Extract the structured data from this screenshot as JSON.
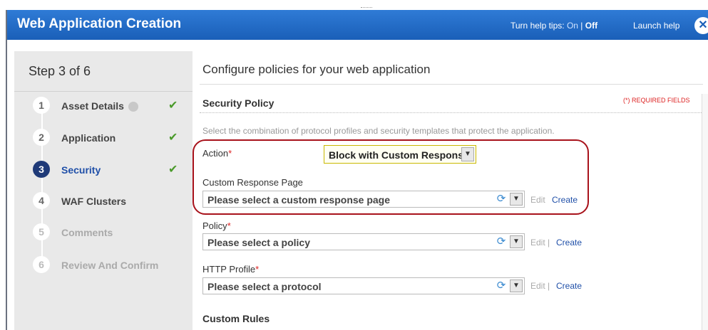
{
  "window": {
    "title": "Web Application Creation",
    "help_tips_label": "Turn help tips:",
    "help_on": "On",
    "help_sep": "|",
    "help_off": "Off",
    "launch_help": "Launch help",
    "close_icon": "close-icon"
  },
  "sidebar": {
    "step_heading": "Step 3 of 6",
    "steps": [
      {
        "num": "1",
        "label": "Asset Details",
        "state": "done",
        "has_info": true
      },
      {
        "num": "2",
        "label": "Application",
        "state": "done"
      },
      {
        "num": "3",
        "label": "Security",
        "state": "current"
      },
      {
        "num": "4",
        "label": "WAF Clusters",
        "state": "pending"
      },
      {
        "num": "5",
        "label": "Comments",
        "state": "disabled"
      },
      {
        "num": "6",
        "label": "Review And Confirm",
        "state": "disabled"
      }
    ]
  },
  "main": {
    "page_title": "Configure policies for your web application",
    "section_title": "Security Policy",
    "required_note": "(*) REQUIRED FIELDS",
    "description": "Select the combination of protocol profiles and security templates that protect the application.",
    "action": {
      "label": "Action",
      "value": "Block with Custom Response"
    },
    "custom_response": {
      "label": "Custom Response Page",
      "placeholder": "Please select a custom response page",
      "edit": "Edit",
      "create": "Create"
    },
    "policy": {
      "label": "Policy",
      "placeholder": "Please select a policy",
      "edit": "Edit",
      "sep": "|",
      "create": "Create"
    },
    "http_profile": {
      "label": "HTTP Profile",
      "placeholder": "Please select a protocol",
      "edit": "Edit",
      "sep": "|",
      "create": "Create"
    },
    "custom_rules_title": "Custom Rules",
    "required_marker": "*"
  },
  "colors": {
    "titlebar": "#1a5fb8",
    "current_step": "#1f3a78",
    "highlight_ring": "#a8121b",
    "required": "#dd2222"
  }
}
